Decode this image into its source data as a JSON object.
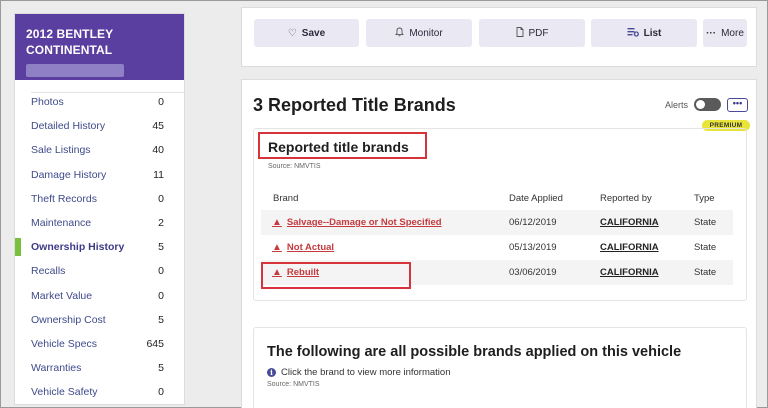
{
  "vehicle": {
    "title_line1": "2012 BENTLEY",
    "title_line2": "CONTINENTAL"
  },
  "sidebar": {
    "items": [
      {
        "label": "Photos",
        "count": "0"
      },
      {
        "label": "Detailed History",
        "count": "45"
      },
      {
        "label": "Sale Listings",
        "count": "40"
      },
      {
        "label": "Damage History",
        "count": "11"
      },
      {
        "label": "Theft Records",
        "count": "0"
      },
      {
        "label": "Maintenance",
        "count": "2"
      },
      {
        "label": "Ownership History",
        "count": "5"
      },
      {
        "label": "Recalls",
        "count": "0"
      },
      {
        "label": "Market Value",
        "count": "0"
      },
      {
        "label": "Ownership Cost",
        "count": "5"
      },
      {
        "label": "Vehicle Specs",
        "count": "645"
      },
      {
        "label": "Warranties",
        "count": "5"
      },
      {
        "label": "Vehicle Safety",
        "count": "0"
      }
    ],
    "active": "Ownership History"
  },
  "toolbar": {
    "save_label": "Save",
    "monitor_label": "Monitor",
    "pdf_label": "PDF",
    "list_label": "List",
    "more_label": "More"
  },
  "main": {
    "title": "3 Reported Title Brands",
    "alerts_label": "Alerts",
    "more_dots": "•••",
    "premium_label": "PREMIUM"
  },
  "brands": {
    "section_title": "Reported title brands",
    "source": "Source: NMVTIS",
    "headers": {
      "brand": "Brand",
      "date": "Date Applied",
      "reported_by": "Reported by",
      "type": "Type"
    },
    "rows": [
      {
        "brand": "Salvage--Damage or Not Specified",
        "date": "06/12/2019",
        "reported_by": "CALIFORNIA",
        "type": "State"
      },
      {
        "brand": "Not Actual",
        "date": "05/13/2019",
        "reported_by": "CALIFORNIA",
        "type": "State"
      },
      {
        "brand": "Rebuilt",
        "date": "03/06/2019",
        "reported_by": "CALIFORNIA",
        "type": "State"
      }
    ]
  },
  "possible": {
    "title": "The following are all possible brands applied on this vehicle",
    "info": "Click the brand to view more information",
    "source": "Source: NMVTIS"
  },
  "colors": {
    "header_purple": "#5b3fa0",
    "active_green": "#7bbf3f",
    "alert_red": "#c53a3e",
    "premium_yellow": "#e9e43a"
  }
}
